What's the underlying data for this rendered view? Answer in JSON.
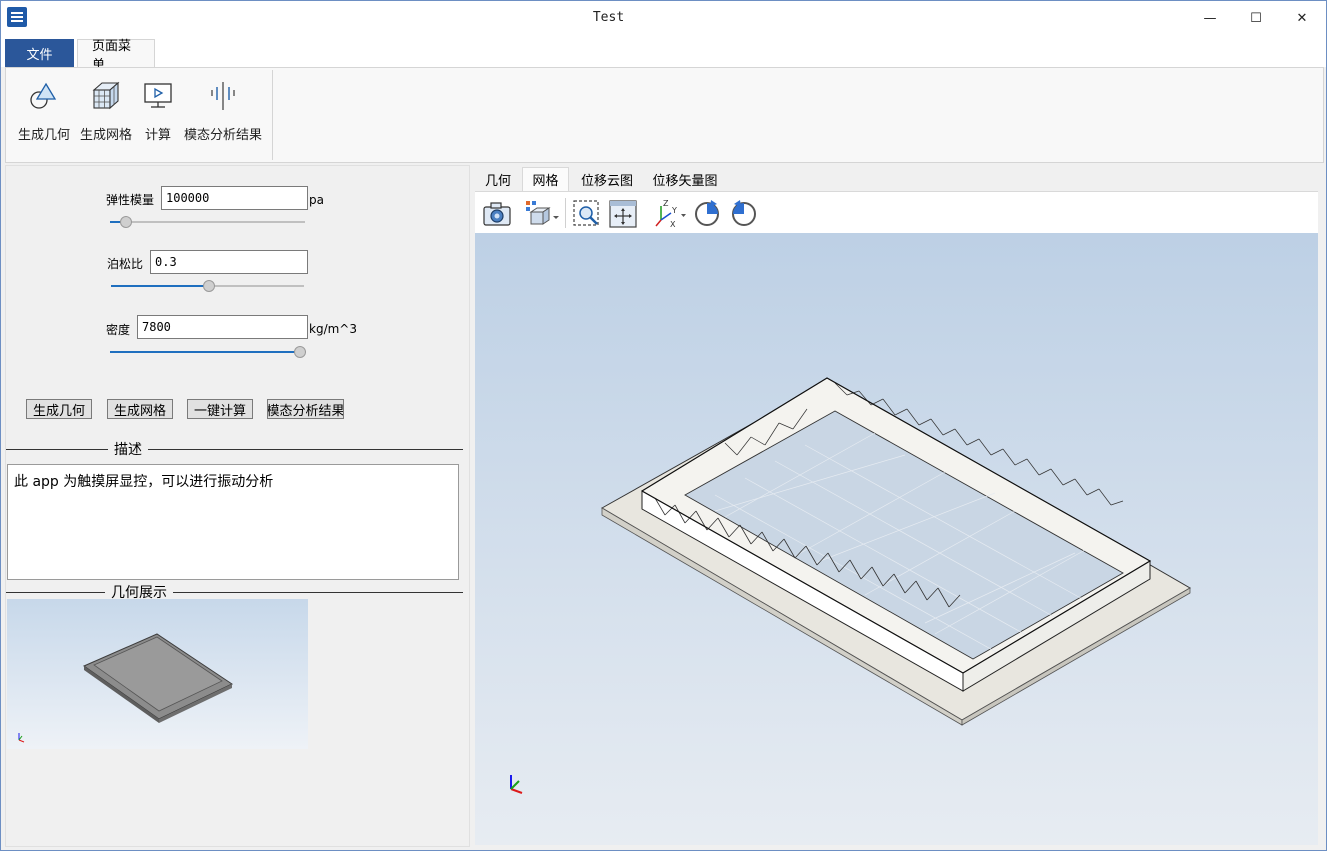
{
  "window": {
    "title": "Test"
  },
  "window_controls": {
    "minimize": "—",
    "maximize": "☐",
    "close": "✕"
  },
  "ribbon": {
    "tabs": [
      {
        "label": "文件"
      },
      {
        "label": "页面菜单"
      }
    ],
    "buttons": [
      {
        "label": "生成几何",
        "icon": "geometry-icon"
      },
      {
        "label": "生成网格",
        "icon": "mesh-icon"
      },
      {
        "label": "计算",
        "icon": "compute-icon"
      },
      {
        "label": "模态分析结果",
        "icon": "modal-result-icon"
      }
    ]
  },
  "params": {
    "elastic_modulus": {
      "label": "弹性模量",
      "value": "100000",
      "unit": "pa",
      "slider_fraction": 0.07
    },
    "poisson_ratio": {
      "label": "泊松比",
      "value": "0.3",
      "slider_fraction": 0.5
    },
    "density": {
      "label": "密度",
      "value": "7800",
      "unit": "kg/m^3",
      "slider_fraction": 1.0
    }
  },
  "actions": {
    "gen_geometry": "生成几何",
    "gen_mesh": "生成网格",
    "one_click_compute": "一键计算",
    "modal_result": "模态分析结果"
  },
  "description": {
    "title": "描述",
    "text": "此 app 为触摸屏显控，可以进行振动分析"
  },
  "geometry_display": {
    "title": "几何展示"
  },
  "view": {
    "tabs": [
      {
        "label": "几何"
      },
      {
        "label": "网格",
        "active": true
      },
      {
        "label": "位移云图"
      },
      {
        "label": "位移矢量图"
      }
    ],
    "toolbar": [
      "camera-icon",
      "view-cube-icon",
      "zoom-box-icon",
      "fit-all-icon",
      "axis-orientation-icon",
      "rotate-cw-icon",
      "rotate-ccw-icon"
    ]
  }
}
